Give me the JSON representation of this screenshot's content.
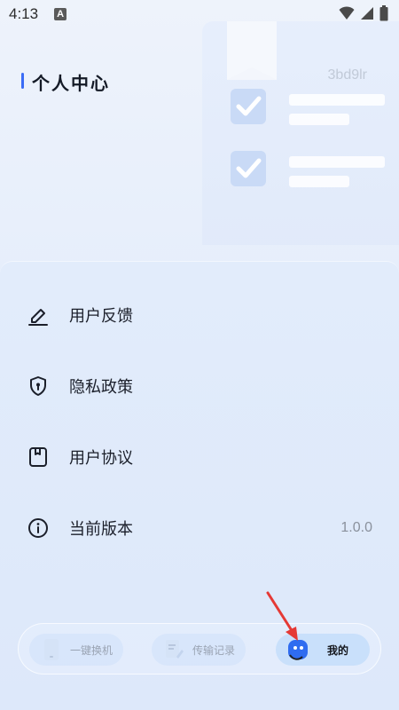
{
  "status_bar": {
    "time": "4:13",
    "notification_badge": "A"
  },
  "header": {
    "title": "个人中心",
    "user_id": "3bd9lr"
  },
  "menu": {
    "items": [
      {
        "label": "用户反馈",
        "icon": "edit-icon"
      },
      {
        "label": "隐私政策",
        "icon": "shield-icon"
      },
      {
        "label": "用户协议",
        "icon": "bookmark-icon"
      },
      {
        "label": "当前版本",
        "icon": "info-icon",
        "value": "1.0.0"
      }
    ]
  },
  "tab_bar": {
    "tabs": [
      {
        "label": "一键换机",
        "icon": "phone-icon",
        "active": false
      },
      {
        "label": "传输记录",
        "icon": "document-icon",
        "active": false
      },
      {
        "label": "我的",
        "icon": "avatar-icon",
        "active": true
      }
    ]
  },
  "colors": {
    "accent": "#3b6cf6",
    "annotation_arrow": "#e53935"
  }
}
